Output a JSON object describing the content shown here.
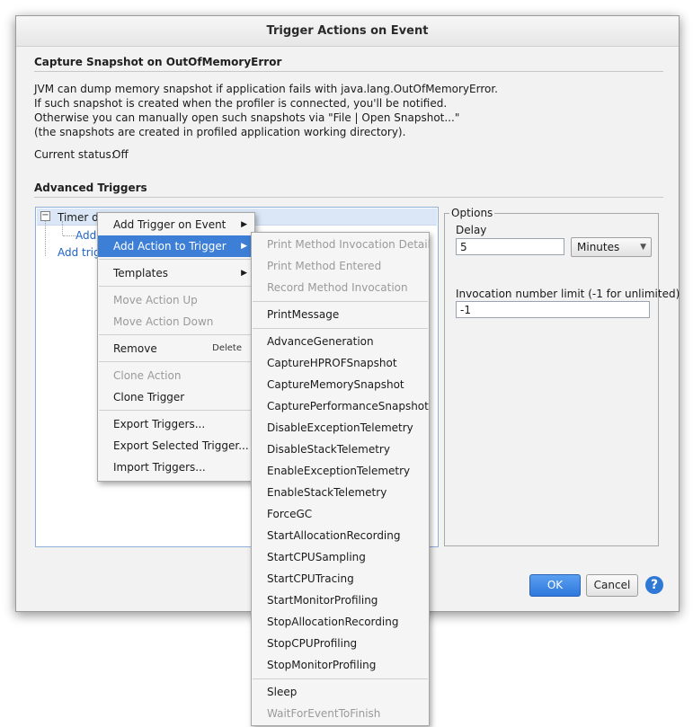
{
  "window": {
    "title": "Trigger Actions on Event"
  },
  "capture": {
    "heading": "Capture Snapshot on OutOfMemoryError",
    "lines": [
      "JVM can dump memory snapshot if application fails with java.lang.OutOfMemoryError.",
      "If such snapshot is created when the profiler is connected, you'll be notified.",
      "Otherwise you can manually open such snapshots via \"File | Open Snapshot...\"",
      "(the snapshots are created in profiled application working directory)."
    ],
    "status_label": "Current status:",
    "status_value": "Off"
  },
  "advanced": {
    "heading": "Advanced Triggers",
    "tree": {
      "root_label": "Timer de",
      "child_label": "Add",
      "add_trigger_label": "Add trig"
    }
  },
  "options": {
    "legend": "Options",
    "delay_label": "Delay",
    "delay_value": "5",
    "delay_unit": "Minutes",
    "limit_label": "Invocation number limit (-1 for unlimited)",
    "limit_value": "-1"
  },
  "buttons": {
    "ok": "OK",
    "cancel": "Cancel",
    "help": "?"
  },
  "context_menu": {
    "add_trigger_on_event": "Add Trigger on Event",
    "add_action_to_trigger": "Add Action to Trigger",
    "templates": "Templates",
    "move_action_up": "Move Action Up",
    "move_action_down": "Move Action Down",
    "remove": "Remove",
    "remove_shortcut": "Delete",
    "clone_action": "Clone Action",
    "clone_trigger": "Clone Trigger",
    "export_triggers": "Export Triggers...",
    "export_selected_trigger": "Export Selected Trigger...",
    "import_triggers": "Import Triggers..."
  },
  "submenu": {
    "print_method_invocation_detail": "Print Method Invocation Detail",
    "print_method_entered": "Print Method Entered",
    "record_method_invocation": "Record Method Invocation",
    "print_message": "PrintMessage",
    "actions": [
      "AdvanceGeneration",
      "CaptureHPROFSnapshot",
      "CaptureMemorySnapshot",
      "CapturePerformanceSnapshot",
      "DisableExceptionTelemetry",
      "DisableStackTelemetry",
      "EnableExceptionTelemetry",
      "EnableStackTelemetry",
      "ForceGC",
      "StartAllocationRecording",
      "StartCPUSampling",
      "StartCPUTracing",
      "StartMonitorProfiling",
      "StopAllocationRecording",
      "StopCPUProfiling",
      "StopMonitorProfiling"
    ],
    "sleep": "Sleep",
    "wait_for_event_to_finish": "WaitForEventToFinish"
  },
  "colors": {
    "accent": "#3d7fd6",
    "link": "#1f63c6",
    "ok_button": "#2f78dc"
  }
}
